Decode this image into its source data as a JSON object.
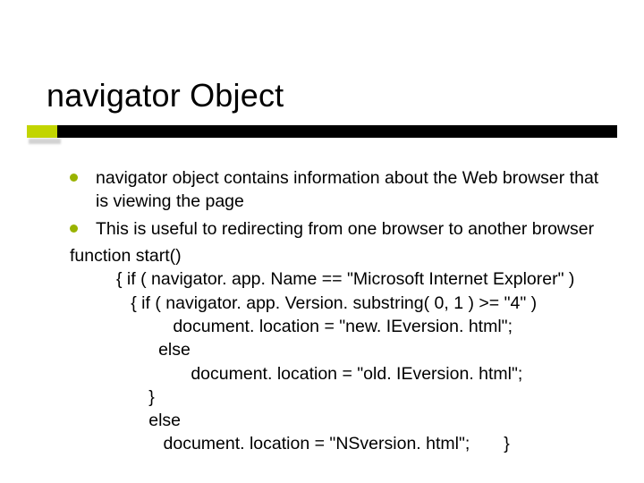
{
  "title": "navigator Object",
  "bullets": [
    "navigator object contains information about the Web browser that is viewing the page",
    "This is useful to redirecting from one browser to another browser"
  ],
  "code": {
    "l0": "function start()",
    "l1": "{ if ( navigator. app. Name == \"Microsoft Internet Explorer\" )",
    "l2": "   { if ( navigator. app. Version. substring( 0, 1 ) >= \"4\" )",
    "l3": "        document. location = \"new. IEversion. html\";",
    "l4": "     else",
    "l5": "        document. location = \"old. IEversion. html\";",
    "l6": "   }",
    "l7": "   else",
    "l8": "      document. location = \"NSversion. html\";       }"
  }
}
